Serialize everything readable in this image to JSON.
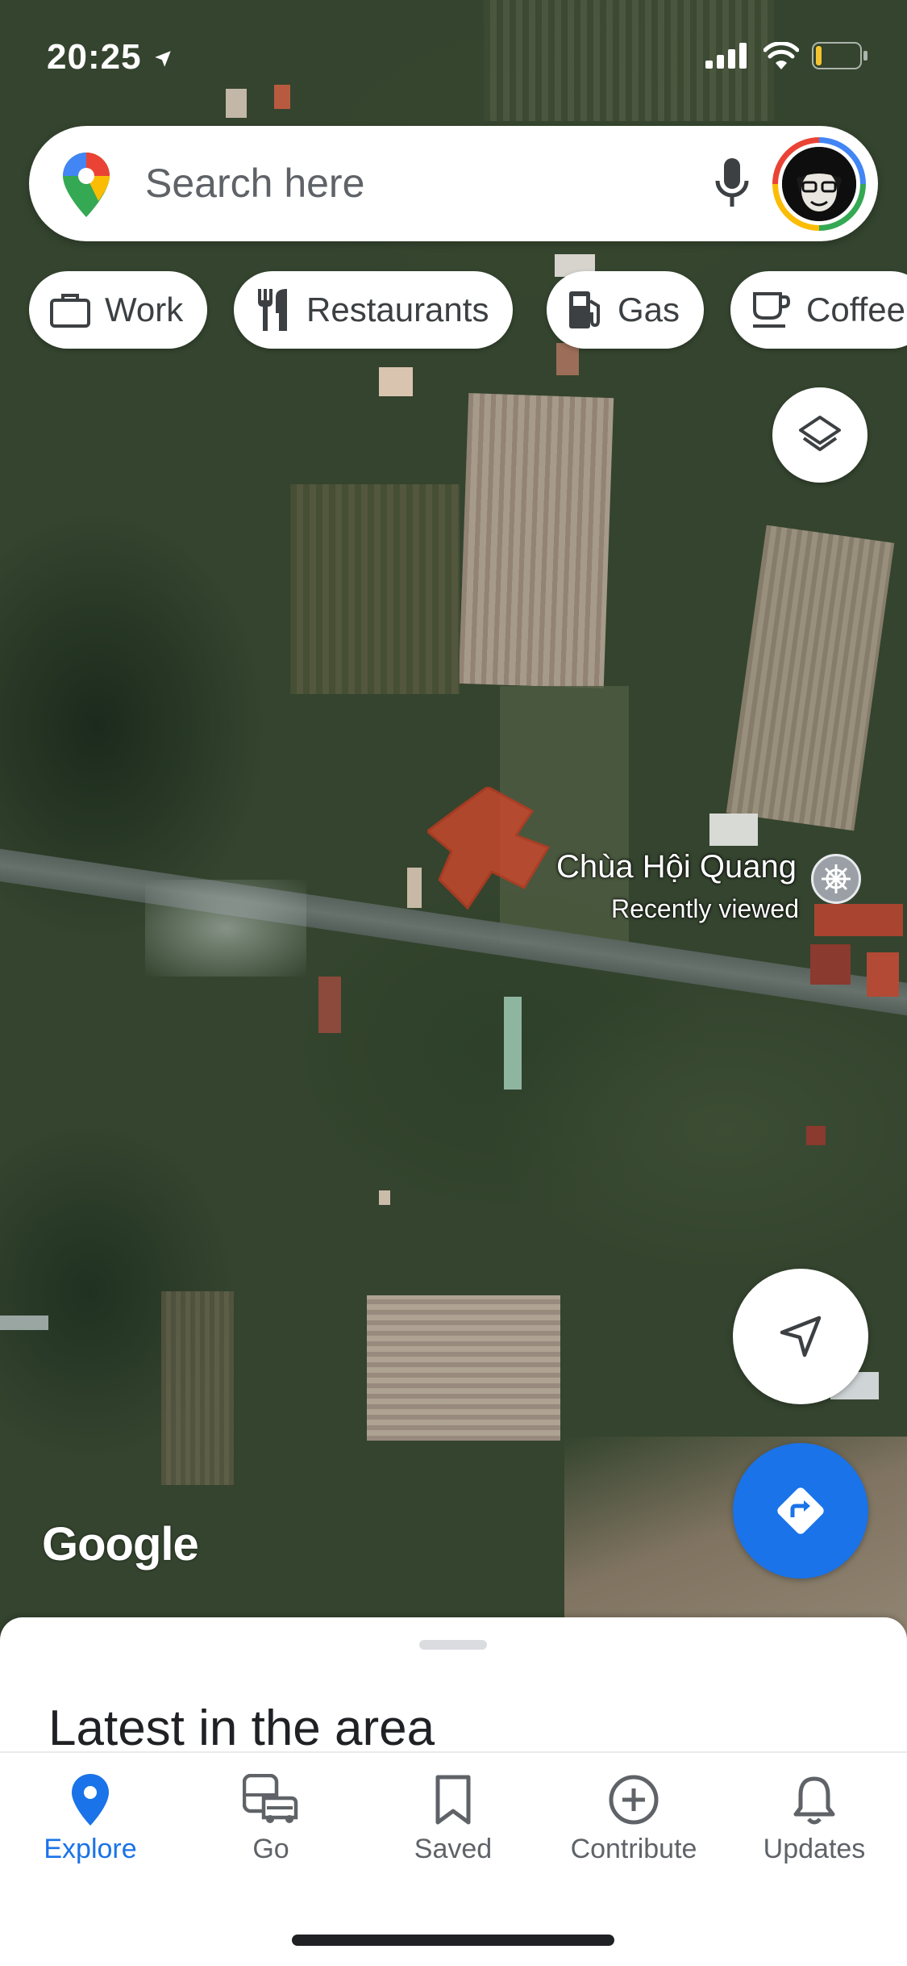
{
  "status_bar": {
    "time": "20:25",
    "icons": [
      "location-arrow-icon",
      "signal-icon",
      "wifi-icon",
      "battery-icon"
    ]
  },
  "search": {
    "placeholder": "Search here",
    "icons": [
      "google-maps-pin-icon",
      "microphone-icon",
      "avatar"
    ]
  },
  "chips": [
    {
      "label": "Work",
      "icon": "briefcase-icon"
    },
    {
      "label": "Restaurants",
      "icon": "fork-knife-icon"
    },
    {
      "label": "Gas",
      "icon": "gas-pump-icon"
    },
    {
      "label": "Coffee",
      "icon": "coffee-cup-icon"
    }
  ],
  "map": {
    "place_name": "Chùa Hội Quang",
    "place_subtitle": "Recently viewed",
    "place_icon": "temple-wheel-icon",
    "logo": "Google",
    "colors": {
      "parcel": "#d9482c",
      "accent": "#1a73e8"
    }
  },
  "controls": {
    "layers": "layers-icon",
    "my_location": "navigation-arrow-icon",
    "directions": "directions-icon"
  },
  "sheet": {
    "title": "Latest in the area"
  },
  "nav": {
    "items": [
      {
        "label": "Explore",
        "icon": "location-pin-icon",
        "active": true
      },
      {
        "label": "Go",
        "icon": "commute-icon",
        "active": false
      },
      {
        "label": "Saved",
        "icon": "bookmark-icon",
        "active": false
      },
      {
        "label": "Contribute",
        "icon": "add-circle-icon",
        "active": false
      },
      {
        "label": "Updates",
        "icon": "bell-icon",
        "active": false
      }
    ]
  }
}
